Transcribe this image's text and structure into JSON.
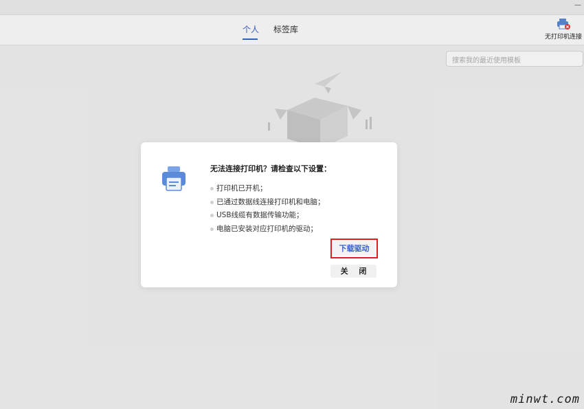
{
  "tabs": [
    {
      "label": "个人",
      "active": true
    },
    {
      "label": "标签库",
      "active": false
    }
  ],
  "printer_status": {
    "label": "无打印机连接"
  },
  "search": {
    "placeholder": "搜索我的最近使用模板"
  },
  "dialog": {
    "title": "无法连接打印机？请检查以下设置：",
    "items": [
      "打印机已开机；",
      "已通过数据线连接打印机和电脑；",
      "USB线缆有数据传输功能；",
      "电脑已安装对应打印机的驱动；"
    ],
    "download_label": "下载驱动",
    "close_label": "关 闭"
  },
  "watermark": "minwt.com",
  "colors": {
    "accent": "#3b62c6",
    "highlight": "#e11e1e",
    "printer_icon": "#5b8ad8"
  }
}
